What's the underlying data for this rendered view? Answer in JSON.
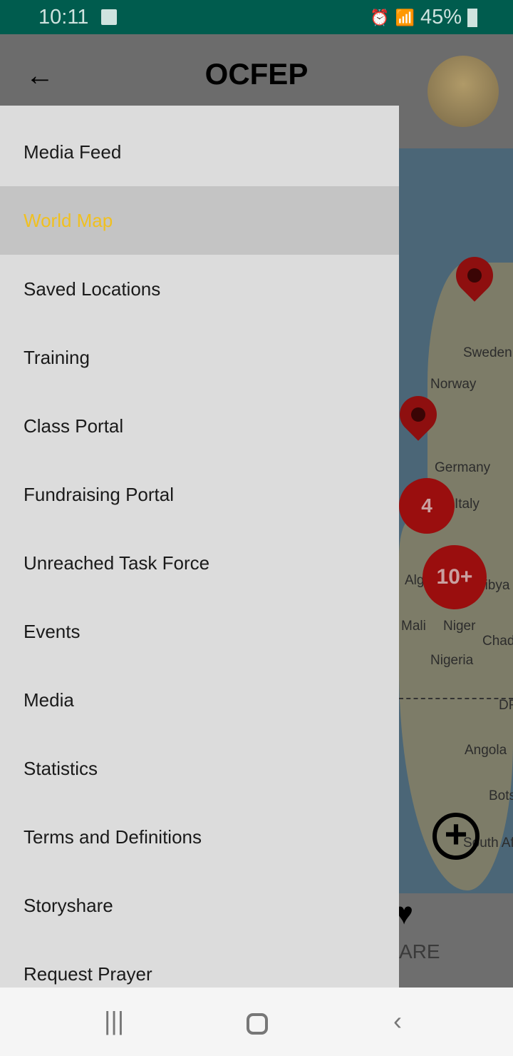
{
  "status_bar": {
    "time": "10:11",
    "battery": "45%",
    "icons": [
      "image-icon",
      "alarm-icon",
      "wifi-icon",
      "signal-icon",
      "battery-charging-icon"
    ]
  },
  "app_bar": {
    "title": "OCFEP",
    "back_icon": "arrow-left-icon"
  },
  "drawer": {
    "items": [
      {
        "label": "Media Feed"
      },
      {
        "label": "World Map",
        "selected": true
      },
      {
        "label": "Saved Locations"
      },
      {
        "label": "Training"
      },
      {
        "label": "Class Portal"
      },
      {
        "label": "Fundraising Portal"
      },
      {
        "label": "Unreached Task Force"
      },
      {
        "label": "Events"
      },
      {
        "label": "Media"
      },
      {
        "label": "Statistics"
      },
      {
        "label": "Terms and Definitions"
      },
      {
        "label": "Storyshare"
      },
      {
        "label": "Request Prayer"
      }
    ],
    "selected_color": "#f0c020"
  },
  "map": {
    "labels": [
      "Sweden",
      "Norway",
      "Germany",
      "Italy",
      "Alg",
      "Libya",
      "Mali",
      "Niger",
      "Chad",
      "Nigeria",
      "DR",
      "Angola",
      "Bots",
      "South Af"
    ],
    "clusters": [
      "4",
      "10+"
    ]
  },
  "bottom": {
    "share_label": "ARE"
  }
}
